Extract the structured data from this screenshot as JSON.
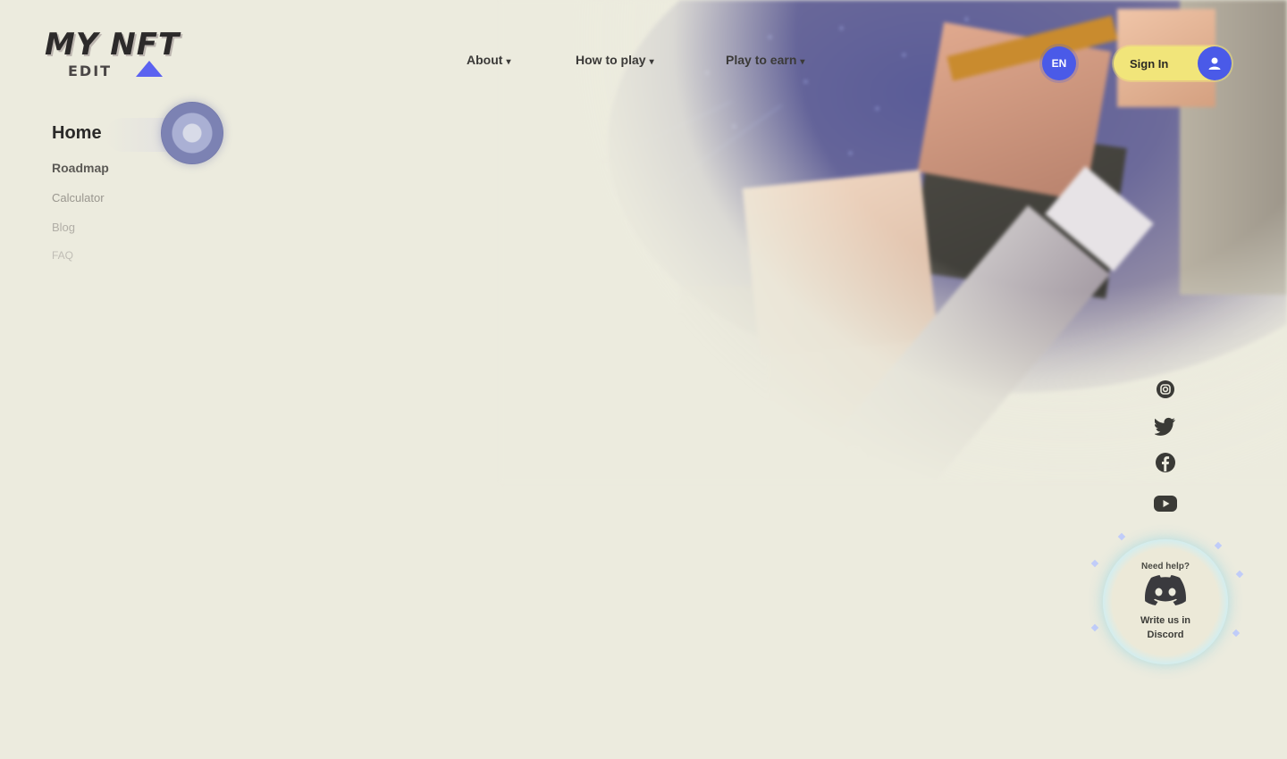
{
  "brand": {
    "logo_text": "MY NFT",
    "logo_sub": "EDIT",
    "accent": "#5b62f0"
  },
  "header": {
    "nav": [
      {
        "label": "About",
        "caret": "▾"
      },
      {
        "label": "How to play",
        "caret": "▾"
      },
      {
        "label": "Play to earn",
        "caret": "▾"
      }
    ],
    "lang_label": "EN",
    "signin_label": "Sign In",
    "signin_color": "#f1e57a",
    "button_color": "#4a5ae8"
  },
  "sidebar": {
    "items": [
      {
        "label": "Home",
        "active": true
      },
      {
        "label": "Roadmap"
      },
      {
        "label": "Calculator"
      },
      {
        "label": "Blog"
      },
      {
        "label": "FAQ"
      }
    ]
  },
  "social": {
    "icons": [
      "instagram-icon",
      "twitter-icon",
      "facebook-icon",
      "youtube-icon"
    ]
  },
  "help": {
    "top_text": "Need help?",
    "bottom_text": "Write us in Discord",
    "icon": "discord-icon"
  }
}
